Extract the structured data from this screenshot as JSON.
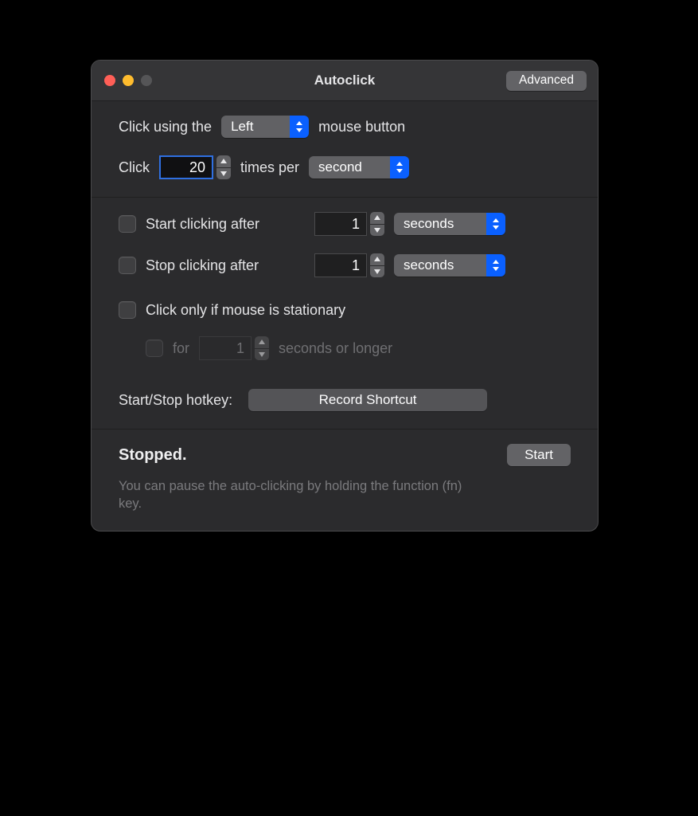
{
  "window": {
    "title": "Autoclick",
    "advanced_button": "Advanced"
  },
  "section1": {
    "click_using_pre": "Click using the",
    "click_using_post": "mouse button",
    "mouse_button_select": "Left",
    "click_pre": "Click",
    "click_count": "20",
    "times_per": "times per",
    "time_unit_select": "second"
  },
  "section2": {
    "start_after_label": "Start clicking after",
    "start_after_value": "1",
    "start_after_unit": "seconds",
    "stop_after_label": "Stop clicking after",
    "stop_after_value": "1",
    "stop_after_unit": "seconds",
    "stationary_label": "Click only if mouse is stationary",
    "stationary_for_label": "for",
    "stationary_for_value": "1",
    "stationary_for_post": "seconds or longer",
    "hotkey_label": "Start/Stop hotkey:",
    "hotkey_button": "Record Shortcut"
  },
  "section3": {
    "status": "Stopped.",
    "start_button": "Start",
    "hint": "You can pause the auto-clicking by holding the function (fn) key."
  }
}
